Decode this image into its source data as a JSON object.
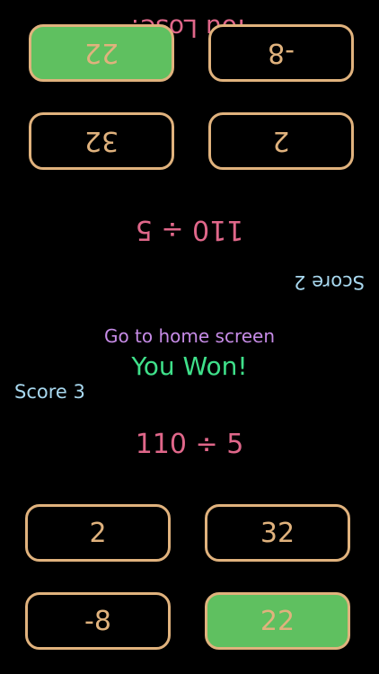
{
  "player_top": {
    "score_label": "Score 2",
    "question": "110 ÷ 5",
    "result": "You Lose!",
    "answers": [
      "2",
      "32",
      "-8",
      "22"
    ]
  },
  "player_bottom": {
    "score_label": "Score 3",
    "question": "110 ÷ 5",
    "result": "You Won!",
    "answers": [
      "2",
      "32",
      "-8",
      "22"
    ]
  },
  "home_link": "Go to home screen",
  "colors": {
    "background": "#000000",
    "button_border": "#e0b27d",
    "correct_fill": "#5fc060",
    "question": "#e0678a",
    "score": "#a8d8ef",
    "won": "#3fe08a",
    "link": "#c68be6"
  }
}
